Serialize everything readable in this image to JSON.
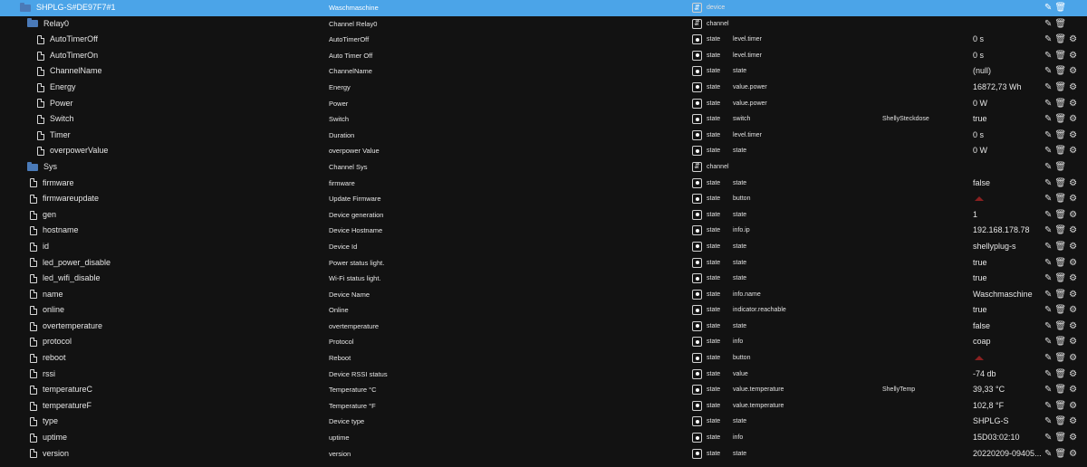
{
  "rows": [
    {
      "id": "SHPLG-S#DE97F7#1",
      "desc": "Waschmaschine",
      "objtype": "device",
      "role": "",
      "room": "",
      "value": "",
      "icon": "folder",
      "indent": 22,
      "selected": true,
      "actions": [
        "edit",
        "delete"
      ]
    },
    {
      "id": "Relay0",
      "desc": "Channel Relay0",
      "objtype": "channel",
      "role": "",
      "room": "",
      "value": "",
      "icon": "folder",
      "indent": 30,
      "actions": [
        "edit",
        "delete"
      ]
    },
    {
      "id": "AutoTimerOff",
      "desc": "AutoTimerOff",
      "objtype": "state",
      "role": "level.timer",
      "room": "",
      "value": "0 s",
      "icon": "file",
      "indent": 41,
      "actions": [
        "edit",
        "delete",
        "settings"
      ]
    },
    {
      "id": "AutoTimerOn",
      "desc": "Auto Timer Off",
      "objtype": "state",
      "role": "level.timer",
      "room": "",
      "value": "0 s",
      "icon": "file",
      "indent": 41,
      "actions": [
        "edit",
        "delete",
        "settings"
      ]
    },
    {
      "id": "ChannelName",
      "desc": "ChannelName",
      "objtype": "state",
      "role": "state",
      "room": "",
      "value": "(null)",
      "icon": "file",
      "indent": 41,
      "actions": [
        "edit",
        "delete",
        "settings"
      ]
    },
    {
      "id": "Energy",
      "desc": "Energy",
      "objtype": "state",
      "role": "value.power",
      "room": "",
      "value": "16872,73 Wh",
      "icon": "file",
      "indent": 41,
      "actions": [
        "edit",
        "delete",
        "settings"
      ]
    },
    {
      "id": "Power",
      "desc": "Power",
      "objtype": "state",
      "role": "value.power",
      "room": "",
      "value": "0 W",
      "icon": "file",
      "indent": 41,
      "actions": [
        "edit",
        "delete",
        "settings"
      ]
    },
    {
      "id": "Switch",
      "desc": "Switch",
      "objtype": "state",
      "role": "switch",
      "room": "ShellySteckdose",
      "value": "true",
      "icon": "file",
      "indent": 41,
      "actions": [
        "edit",
        "delete",
        "settings"
      ]
    },
    {
      "id": "Timer",
      "desc": "Duration",
      "objtype": "state",
      "role": "level.timer",
      "room": "",
      "value": "0 s",
      "icon": "file",
      "indent": 41,
      "actions": [
        "edit",
        "delete",
        "settings"
      ]
    },
    {
      "id": "overpowerValue",
      "desc": "overpower Value",
      "objtype": "state",
      "role": "state",
      "room": "",
      "value": "0 W",
      "icon": "file",
      "indent": 41,
      "actions": [
        "edit",
        "delete",
        "settings"
      ]
    },
    {
      "id": "Sys",
      "desc": "Channel Sys",
      "objtype": "channel",
      "role": "",
      "room": "",
      "value": "",
      "icon": "folder",
      "indent": 30,
      "actions": [
        "edit",
        "delete"
      ]
    },
    {
      "id": "firmware",
      "desc": "firmware",
      "objtype": "state",
      "role": "state",
      "room": "",
      "value": "false",
      "icon": "file",
      "indent": 33,
      "actions": [
        "edit",
        "delete",
        "settings"
      ]
    },
    {
      "id": "firmwareupdate",
      "desc": "Update Firmware",
      "objtype": "state",
      "role": "button",
      "room": "",
      "value": "",
      "icon": "file",
      "indent": 33,
      "button": true,
      "actions": [
        "edit",
        "delete",
        "settings"
      ]
    },
    {
      "id": "gen",
      "desc": "Device generation",
      "objtype": "state",
      "role": "state",
      "room": "",
      "value": "1",
      "icon": "file",
      "indent": 33,
      "actions": [
        "edit",
        "delete",
        "settings"
      ]
    },
    {
      "id": "hostname",
      "desc": "Device Hostname",
      "objtype": "state",
      "role": "info.ip",
      "room": "",
      "value": "192.168.178.78",
      "icon": "file",
      "indent": 33,
      "actions": [
        "edit",
        "delete",
        "settings"
      ]
    },
    {
      "id": "id",
      "desc": "Device Id",
      "objtype": "state",
      "role": "state",
      "room": "",
      "value": "shellyplug-s",
      "icon": "file",
      "indent": 33,
      "actions": [
        "edit",
        "delete",
        "settings"
      ]
    },
    {
      "id": "led_power_disable",
      "desc": "Power status light.",
      "objtype": "state",
      "role": "state",
      "room": "",
      "value": "true",
      "icon": "file",
      "indent": 33,
      "actions": [
        "edit",
        "delete",
        "settings"
      ]
    },
    {
      "id": "led_wifi_disable",
      "desc": "Wi-Fi status light.",
      "objtype": "state",
      "role": "state",
      "room": "",
      "value": "true",
      "icon": "file",
      "indent": 33,
      "actions": [
        "edit",
        "delete",
        "settings"
      ]
    },
    {
      "id": "name",
      "desc": "Device Name",
      "objtype": "state",
      "role": "info.name",
      "room": "",
      "value": "Waschmaschine",
      "icon": "file",
      "indent": 33,
      "actions": [
        "edit",
        "delete",
        "settings"
      ]
    },
    {
      "id": "online",
      "desc": "Online",
      "objtype": "state",
      "role": "indicator.reachable",
      "room": "",
      "value": "true",
      "icon": "file",
      "indent": 33,
      "actions": [
        "edit",
        "delete",
        "settings"
      ]
    },
    {
      "id": "overtemperature",
      "desc": "overtemperature",
      "objtype": "state",
      "role": "state",
      "room": "",
      "value": "false",
      "icon": "file",
      "indent": 33,
      "actions": [
        "edit",
        "delete",
        "settings"
      ]
    },
    {
      "id": "protocol",
      "desc": "Protocol",
      "objtype": "state",
      "role": "info",
      "room": "",
      "value": "coap",
      "icon": "file",
      "indent": 33,
      "actions": [
        "edit",
        "delete",
        "settings"
      ]
    },
    {
      "id": "reboot",
      "desc": "Reboot",
      "objtype": "state",
      "role": "button",
      "room": "",
      "value": "",
      "icon": "file",
      "indent": 33,
      "button": true,
      "actions": [
        "edit",
        "delete",
        "settings"
      ]
    },
    {
      "id": "rssi",
      "desc": "Device RSSI status",
      "objtype": "state",
      "role": "value",
      "room": "",
      "value": "-74 db",
      "icon": "file",
      "indent": 33,
      "actions": [
        "edit",
        "delete",
        "settings"
      ]
    },
    {
      "id": "temperatureC",
      "desc": "Temperature °C",
      "objtype": "state",
      "role": "value.temperature",
      "room": "ShellyTemp",
      "value": "39,33 °C",
      "icon": "file",
      "indent": 33,
      "actions": [
        "edit",
        "delete",
        "settings"
      ]
    },
    {
      "id": "temperatureF",
      "desc": "Temperature °F",
      "objtype": "state",
      "role": "value.temperature",
      "room": "",
      "value": "102,8 °F",
      "icon": "file",
      "indent": 33,
      "actions": [
        "edit",
        "delete",
        "settings"
      ]
    },
    {
      "id": "type",
      "desc": "Device type",
      "objtype": "state",
      "role": "state",
      "room": "",
      "value": "SHPLG-S",
      "icon": "file",
      "indent": 33,
      "actions": [
        "edit",
        "delete",
        "settings"
      ]
    },
    {
      "id": "uptime",
      "desc": "uptime",
      "objtype": "state",
      "role": "info",
      "room": "",
      "value": "15D03:02:10",
      "icon": "file",
      "indent": 33,
      "actions": [
        "edit",
        "delete",
        "settings"
      ]
    },
    {
      "id": "version",
      "desc": "version",
      "objtype": "state",
      "role": "state",
      "room": "",
      "value": "20220209-09405...",
      "icon": "file",
      "indent": 33,
      "actions": [
        "edit",
        "delete",
        "settings"
      ]
    }
  ]
}
